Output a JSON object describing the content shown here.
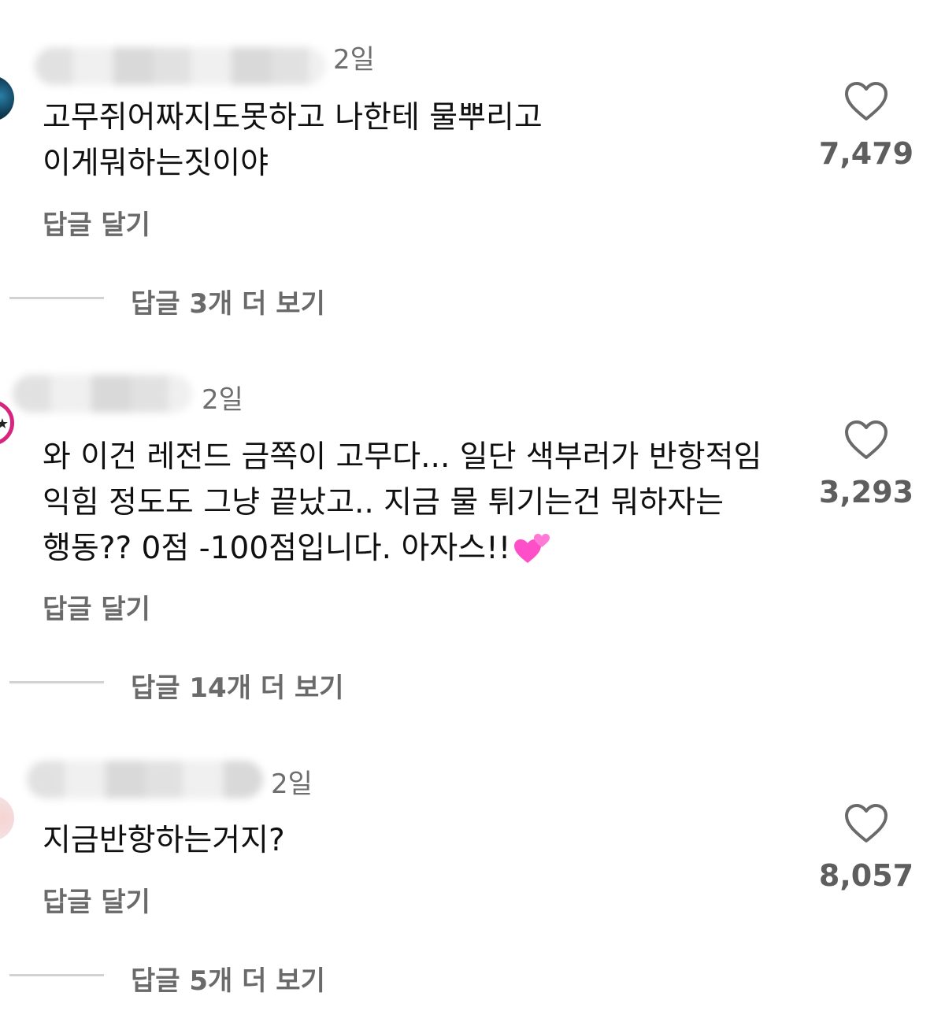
{
  "comments": [
    {
      "time": "2일",
      "lines": [
        "고무쥐어짜지도못하고 나한테 물뿌리고",
        "이게뭐하는짓이야"
      ],
      "reply_label": "답글 달기",
      "likes": "7,479",
      "view_replies": "답글 3개 더 보기"
    },
    {
      "time": "2일",
      "lines": [
        "와 이건 레전드 금쪽이 고무다... 일단 색부러가 반항적임",
        "익힘 정도도 그냥 끝났고.. 지금 물 튀기는건 뭐하자는",
        "행동?? 0점 -100점입니다. 아자스!!"
      ],
      "reply_label": "답글 달기",
      "likes": "3,293",
      "view_replies": "답글 14개 더 보기"
    },
    {
      "time": "2일",
      "lines": [
        "지금반항하는거지?"
      ],
      "reply_label": "답글 달기",
      "likes": "8,057",
      "view_replies": "답글 5개 더 보기"
    }
  ],
  "icons": {
    "like": "heart-outline-icon",
    "emoji": "two-hearts-emoji"
  },
  "colors": {
    "secondary_text": "#6e6e6e",
    "emoji_pink": "#ff4fc8",
    "avatar_ring": "#d6247f"
  }
}
